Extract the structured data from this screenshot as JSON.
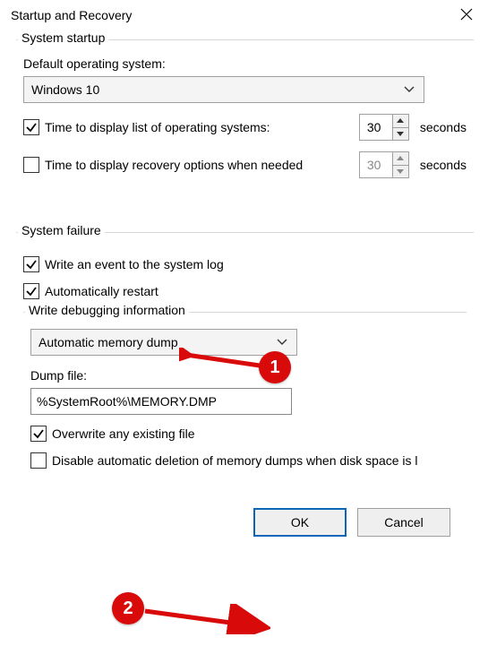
{
  "title": "Startup and Recovery",
  "startup": {
    "group_title": "System startup",
    "default_os_label": "Default operating system:",
    "default_os_value": "Windows 10",
    "time_os_label": "Time to display list of operating systems:",
    "time_os_checked": true,
    "time_os_value": "30",
    "time_rec_label": "Time to display recovery options when needed",
    "time_rec_checked": false,
    "time_rec_value": "30",
    "seconds_label": "seconds"
  },
  "failure": {
    "group_title": "System failure",
    "write_event_label": "Write an event to the system log",
    "write_event_checked": true,
    "auto_restart_label": "Automatically restart",
    "auto_restart_checked": true,
    "debug_group_title": "Write debugging information",
    "debug_select_value": "Automatic memory dump",
    "dump_file_label": "Dump file:",
    "dump_file_value": "%SystemRoot%\\MEMORY.DMP",
    "overwrite_label": "Overwrite any existing file",
    "overwrite_checked": true,
    "disable_auto_del_label": "Disable automatic deletion of memory dumps when disk space is l",
    "disable_auto_del_checked": false
  },
  "buttons": {
    "ok": "OK",
    "cancel": "Cancel"
  },
  "annotations": {
    "badge1": "1",
    "badge2": "2"
  }
}
